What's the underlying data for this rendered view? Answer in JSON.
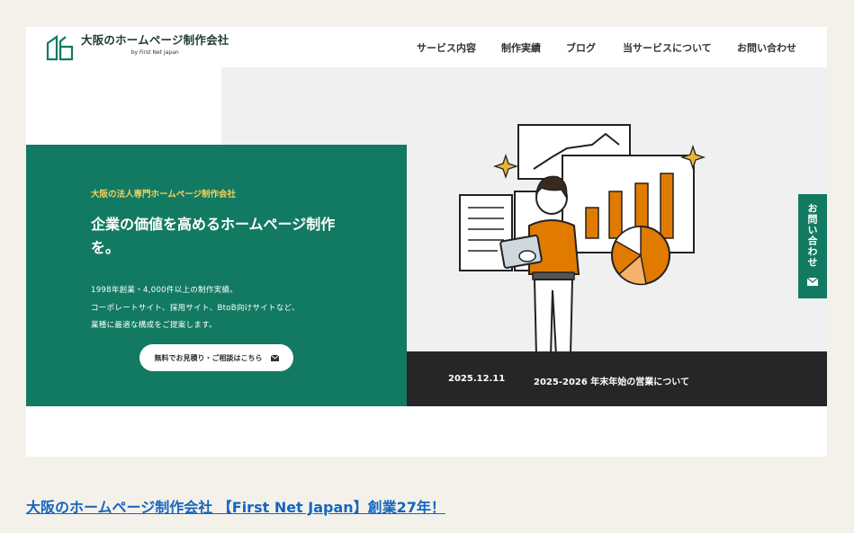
{
  "header": {
    "logo_title": "大阪のホームページ制作会社",
    "logo_sub": "by First Net Japan",
    "nav": [
      {
        "label": "サービス内容"
      },
      {
        "label": "制作実績"
      },
      {
        "label": "ブログ"
      },
      {
        "label": "当サービスについて"
      },
      {
        "label": "お問い合わせ"
      }
    ]
  },
  "hero": {
    "tagline": "大阪の法人専門ホームページ制作会社",
    "headline": "企業の価値を高めるホームページ制作を。",
    "desc_lines": [
      "1998年創業・4,000件以上の制作実績。",
      "コーポレートサイト、採用サイト、BtoB向けサイトなど、",
      "業種に最適な構成をご提案します。"
    ],
    "cta_label": "無料でお見積り・ご相談はこちら"
  },
  "news": {
    "date": "2025.12.11",
    "title": "2025-2026 年末年始の営業について"
  },
  "contact_tab": {
    "label": "お問い合わせ"
  },
  "page_link": "大阪のホームページ制作会社 【First Net Japan】創業27年！",
  "colors": {
    "green": "#127a62",
    "accent_yellow": "#f5d15e",
    "news_bg": "#262626",
    "orange": "#e07b00",
    "link": "#1565c0"
  },
  "icons": [
    "logo-mark",
    "mail-icon",
    "sparkle-icon",
    "chart-illustration"
  ]
}
